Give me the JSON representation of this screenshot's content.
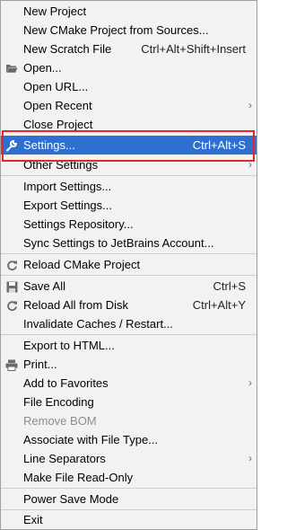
{
  "menu": {
    "items": [
      {
        "label": "New Project"
      },
      {
        "label": "New CMake Project from Sources..."
      },
      {
        "label": "New Scratch File",
        "shortcut": "Ctrl+Alt+Shift+Insert"
      },
      {
        "label": "Open...",
        "icon": "folder-icon"
      },
      {
        "label": "Open URL..."
      },
      {
        "label": "Open Recent",
        "submenu": true
      },
      {
        "label": "Close Project"
      },
      {
        "label": "Settings...",
        "shortcut": "Ctrl+Alt+S",
        "icon": "wrench-icon",
        "selected": true
      },
      {
        "label": "Other Settings",
        "submenu": true
      },
      {
        "label": "Import Settings..."
      },
      {
        "label": "Export Settings..."
      },
      {
        "label": "Settings Repository..."
      },
      {
        "label": "Sync Settings to JetBrains Account..."
      },
      {
        "label": "Reload CMake Project",
        "icon": "reload-icon"
      },
      {
        "label": "Save All",
        "shortcut": "Ctrl+S",
        "icon": "save-icon"
      },
      {
        "label": "Reload All from Disk",
        "shortcut": "Ctrl+Alt+Y",
        "icon": "reload-icon"
      },
      {
        "label": "Invalidate Caches / Restart..."
      },
      {
        "label": "Export to HTML..."
      },
      {
        "label": "Print...",
        "icon": "printer-icon"
      },
      {
        "label": "Add to Favorites",
        "submenu": true
      },
      {
        "label": "File Encoding"
      },
      {
        "label": "Remove BOM",
        "disabled": true
      },
      {
        "label": "Associate with File Type..."
      },
      {
        "label": "Line Separators",
        "submenu": true
      },
      {
        "label": "Make File Read-Only"
      },
      {
        "label": "Power Save Mode"
      },
      {
        "label": "Exit"
      }
    ],
    "submenu_arrow": "›",
    "colors": {
      "background": "#f2f2f2",
      "selection": "#2f6fd0",
      "highlight_box": "#e0282c",
      "disabled_text": "#8c8c8c"
    }
  }
}
